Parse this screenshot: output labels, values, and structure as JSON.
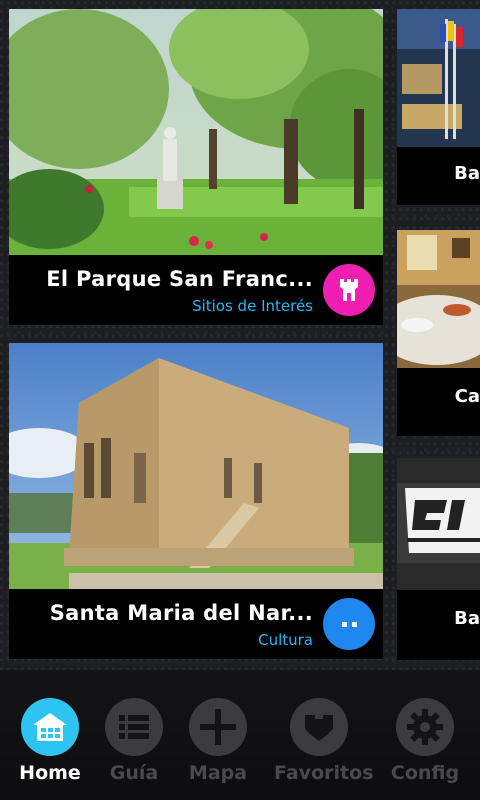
{
  "cards": [
    {
      "title": "El Parque San Franc...",
      "category": "Sitios de Interés",
      "icon": "castle-icon",
      "icon_color": "#ee1fb1"
    },
    {
      "title": "Santa Maria del Nar...",
      "category": "Cultura",
      "icon": "dots-icon",
      "icon_color": "#1e88f0"
    }
  ],
  "side_cards": [
    {
      "title": "Ba"
    },
    {
      "title": "Ca"
    },
    {
      "title": "Ba"
    }
  ],
  "nav": {
    "items": [
      {
        "label": "Home",
        "icon": "home-icon",
        "active": true
      },
      {
        "label": "Guía",
        "icon": "list-icon",
        "active": false
      },
      {
        "label": "Mapa",
        "icon": "crosshair-icon",
        "active": false
      },
      {
        "label": "Favoritos",
        "icon": "heart-icon",
        "active": false
      },
      {
        "label": "Config",
        "icon": "gear-icon",
        "active": false
      }
    ],
    "active_color": "#2ec4f2"
  }
}
